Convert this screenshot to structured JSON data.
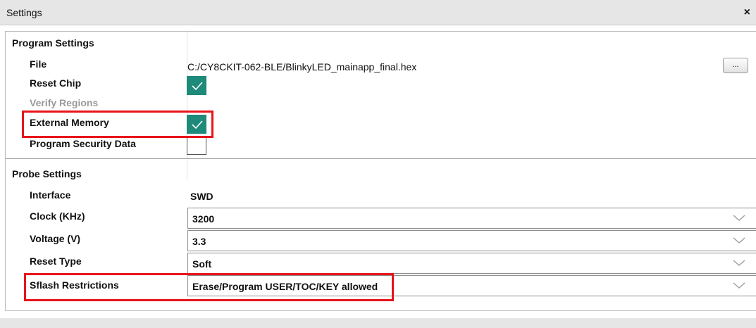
{
  "window": {
    "title": "Settings",
    "close_symbol": "×"
  },
  "program_settings": {
    "group_label": "Program Settings",
    "file_label": "File",
    "file_value": "C:/CY8CKIT-062-BLE/BlinkyLED_mainapp_final.hex",
    "browse_label": "...",
    "reset_chip_label": "Reset Chip",
    "reset_chip_checked": true,
    "verify_regions_label": "Verify Regions",
    "external_memory_label": "External Memory",
    "external_memory_checked": true,
    "program_security_label": "Program Security Data",
    "program_security_checked": false
  },
  "probe_settings": {
    "group_label": "Probe Settings",
    "interface_label": "Interface",
    "interface_value": "SWD",
    "clock_label": "Clock (KHz)",
    "clock_value": "3200",
    "voltage_label": "Voltage (V)",
    "voltage_value": "3.3",
    "reset_type_label": "Reset Type",
    "reset_type_value": "Soft",
    "sflash_label": "Sflash Restrictions",
    "sflash_value": "Erase/Program USER/TOC/KEY allowed"
  },
  "colors": {
    "checkbox_checked": "#1e8a7a",
    "highlight": "#e8141b"
  }
}
